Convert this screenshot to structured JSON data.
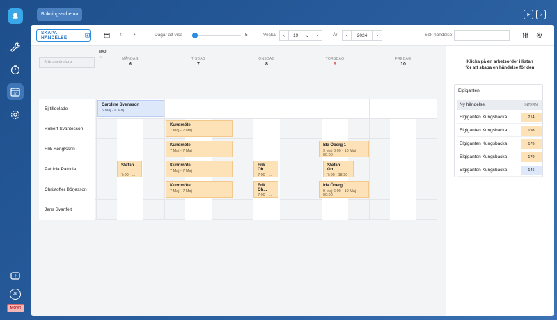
{
  "app": {
    "tab_label": "Bokningsschema",
    "help_label": "?"
  },
  "toolbar": {
    "create_label": "SKAPA HÄNDELSE",
    "days_label": "Dagar att visa",
    "days_value": "5",
    "week_label": "Vecka",
    "week_value": "19",
    "year_label": "År",
    "year_value": "2024",
    "search_label": "Sök händelse"
  },
  "schedule": {
    "month": "MAJ",
    "week_no": "19",
    "user_search_placeholder": "Sök användare",
    "days": [
      {
        "name": "MÅNDAG",
        "date": "6"
      },
      {
        "name": "TISDAG",
        "date": "7"
      },
      {
        "name": "ONSDAG",
        "date": "8"
      },
      {
        "name": "TORSDAG",
        "date": "9"
      },
      {
        "name": "FREDAG",
        "date": "10"
      }
    ],
    "rows": [
      "Ej tilldelade",
      "Robert Svantesson",
      "Erik Bengtsson",
      "Patricia Patricia",
      "Christoffer Börjesson",
      "Jens Svanfelt"
    ],
    "events": {
      "caroline": {
        "title": "Caroline Svensson",
        "sub": "6 Maj - 6 Maj"
      },
      "km1": {
        "title": "Kundmöte",
        "sub": "7 Maj - 7 Maj"
      },
      "km2": {
        "title": "Kundmöte",
        "sub": "7 Maj - 7 Maj"
      },
      "ida1": {
        "title": "Ida Öberg 1",
        "sub": "9 Maj 6:00 - 10 Maj 00:00"
      },
      "stefan1": {
        "title": "Stefan ...",
        "sub": "7:00 - ..."
      },
      "km3": {
        "title": "Kundmöte",
        "sub": "7 Maj - 7 Maj"
      },
      "erik1": {
        "title": "Erik Oh...",
        "sub": "7:00 - ..."
      },
      "stefan2": {
        "title": "Stefan Oh...",
        "sub": "7:00 - 18:30"
      },
      "km4": {
        "title": "Kundmöte",
        "sub": "7 Maj - 7 Maj"
      },
      "erik2": {
        "title": "Erik Oh...",
        "sub": "7:00 - ..."
      },
      "ida2": {
        "title": "Ida Öberg 1",
        "sub": "9 Maj 6:00 - 10 Maj 00:00"
      }
    }
  },
  "panel": {
    "title_line1": "Klicka på en arbetsorder i listan",
    "title_line2": "för att skapa en händelse för den",
    "card_title": "Elgiganten",
    "header": "Ny händelse",
    "header_tag": "INTERN",
    "items": [
      {
        "label": "Elgiganten Kungsbacka",
        "num": "214"
      },
      {
        "label": "Elgiganten Kungsbacka",
        "num": "198"
      },
      {
        "label": "Elgiganten Kungsbacka",
        "num": "176"
      },
      {
        "label": "Elgiganten Kungsbacka",
        "num": "170"
      },
      {
        "label": "Elgiganten Kungsbacka",
        "num": "146"
      }
    ]
  },
  "user": {
    "initials": "JS",
    "badge": "MOW!"
  },
  "colors": {
    "accent": "#2b8de0",
    "event_orange": "#fde2b8",
    "event_blue": "#dde8fb",
    "today_red": "#d9534f"
  }
}
